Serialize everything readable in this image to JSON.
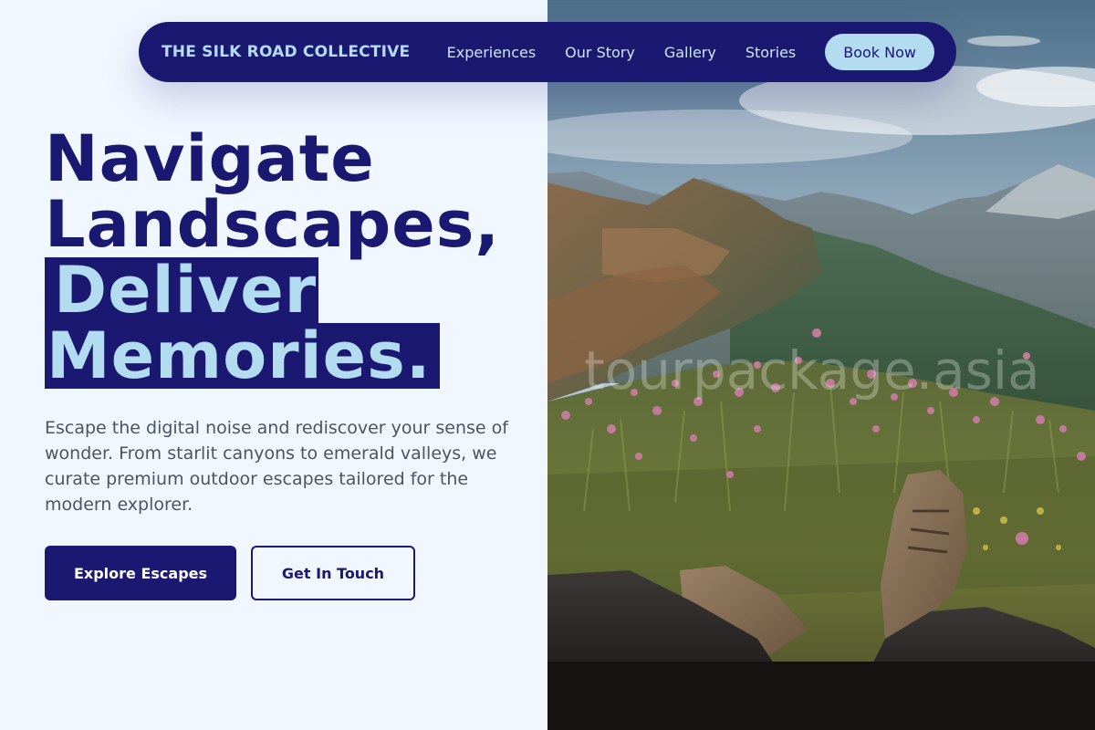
{
  "nav": {
    "brand": "THE SILK ROAD COLLECTIVE",
    "links": [
      "Experiences",
      "Our Story",
      "Gallery",
      "Stories"
    ],
    "cta": "Book Now"
  },
  "hero": {
    "headline_line1": "Navigate",
    "headline_line2": "Landscapes,",
    "headline_highlight1": "Deliver",
    "headline_highlight2": "Memories.",
    "description": "Escape the digital noise and rediscover your sense of wonder. From starlit canyons to emerald valleys, we curate premium outdoor escapes tailored for the modern explorer.",
    "primary_button": "Explore Escapes",
    "secondary_button": "Get In Touch"
  },
  "image": {
    "watermark": "tourpackage.asia"
  },
  "colors": {
    "brand_navy": "#1b1872",
    "accent_sky": "#b3dcf0",
    "page_background": "#f0f7ff"
  }
}
